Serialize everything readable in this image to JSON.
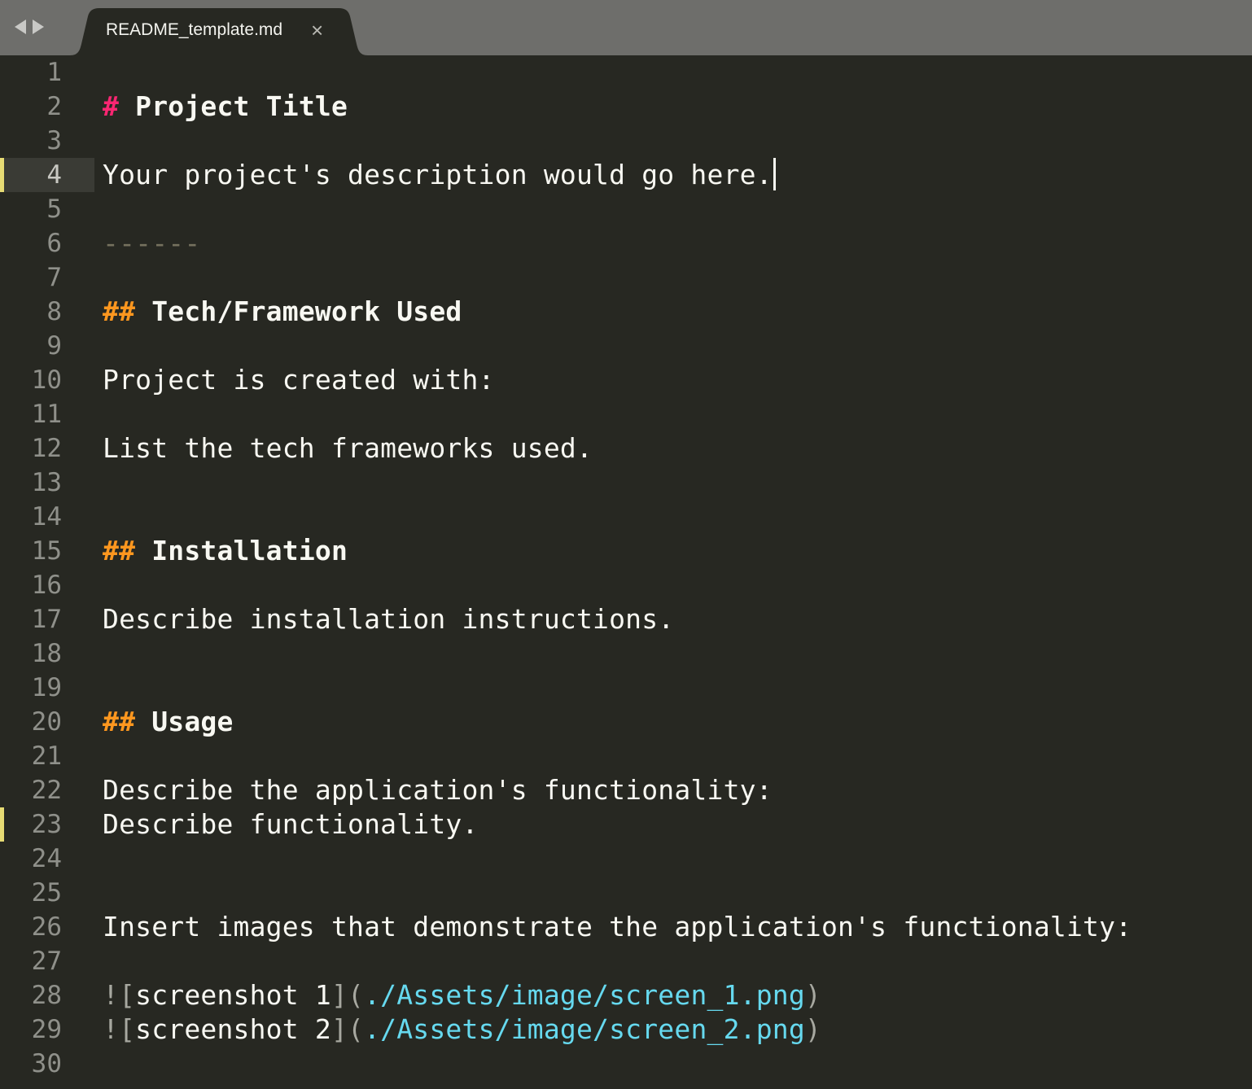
{
  "window": {
    "tab": {
      "filename": "README_template.md",
      "close_glyph": "×"
    }
  },
  "colors": {
    "background": "#272822",
    "heading1_marker": "#f92672",
    "heading2_marker": "#fd971f",
    "link_url": "#66d9ef",
    "modified_marker": "#e6db74"
  },
  "editor": {
    "line_numbers": [
      "1",
      "2",
      "3",
      "4",
      "5",
      "6",
      "7",
      "8",
      "9",
      "10",
      "11",
      "12",
      "13",
      "14",
      "15",
      "16",
      "17",
      "18",
      "19",
      "20",
      "21",
      "22",
      "23",
      "24",
      "25",
      "26",
      "27",
      "28",
      "29",
      "30"
    ],
    "current_line": "4",
    "modified_lines": [
      "4",
      "23"
    ],
    "lines": {
      "l2": {
        "marker": "#",
        "text": " Project Title"
      },
      "l4": {
        "text": "Your project's description would go here."
      },
      "l6": {
        "text": "------"
      },
      "l8": {
        "marker": "##",
        "text": " Tech/Framework Used"
      },
      "l10": {
        "text": "Project is created with:"
      },
      "l12": {
        "text": "List the tech frameworks used."
      },
      "l15": {
        "marker": "##",
        "text": " Installation"
      },
      "l17": {
        "text": "Describe installation instructions."
      },
      "l20": {
        "marker": "##",
        "text": " Usage"
      },
      "l22": {
        "text": "Describe the application's functionality:"
      },
      "l23": {
        "text": "Describe functionality."
      },
      "l26": {
        "text": "Insert images that demonstrate the application's functionality:"
      },
      "l28": {
        "open": "![",
        "alt": "screenshot 1",
        "mid": "](",
        "url": "./Assets/image/screen_1.png",
        "close": ")"
      },
      "l29": {
        "open": "![",
        "alt": "screenshot 2",
        "mid": "](",
        "url": "./Assets/image/screen_2.png",
        "close": ")"
      }
    }
  }
}
